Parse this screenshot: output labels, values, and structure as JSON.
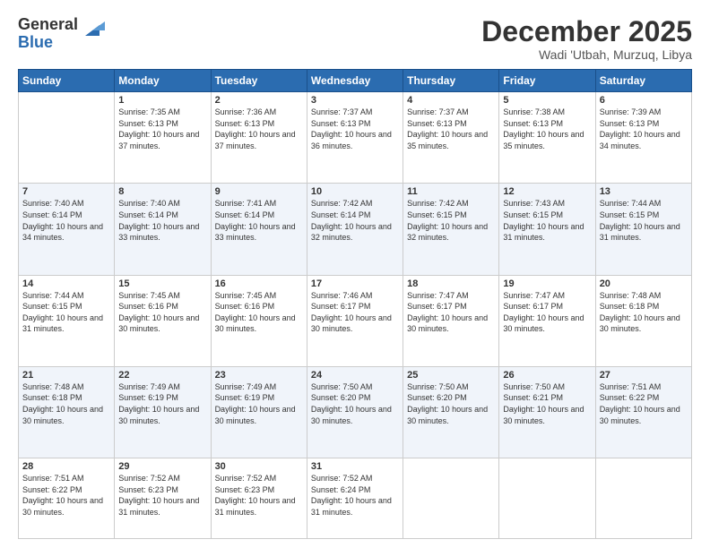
{
  "logo": {
    "general": "General",
    "blue": "Blue"
  },
  "header": {
    "title": "December 2025",
    "location": "Wadi 'Utbah, Murzuq, Libya"
  },
  "weekdays": [
    "Sunday",
    "Monday",
    "Tuesday",
    "Wednesday",
    "Thursday",
    "Friday",
    "Saturday"
  ],
  "days": {
    "1": {
      "sunrise": "7:35 AM",
      "sunset": "6:13 PM",
      "daylight": "10 hours and 37 minutes."
    },
    "2": {
      "sunrise": "7:36 AM",
      "sunset": "6:13 PM",
      "daylight": "10 hours and 37 minutes."
    },
    "3": {
      "sunrise": "7:37 AM",
      "sunset": "6:13 PM",
      "daylight": "10 hours and 36 minutes."
    },
    "4": {
      "sunrise": "7:37 AM",
      "sunset": "6:13 PM",
      "daylight": "10 hours and 35 minutes."
    },
    "5": {
      "sunrise": "7:38 AM",
      "sunset": "6:13 PM",
      "daylight": "10 hours and 35 minutes."
    },
    "6": {
      "sunrise": "7:39 AM",
      "sunset": "6:13 PM",
      "daylight": "10 hours and 34 minutes."
    },
    "7": {
      "sunrise": "7:40 AM",
      "sunset": "6:14 PM",
      "daylight": "10 hours and 34 minutes."
    },
    "8": {
      "sunrise": "7:40 AM",
      "sunset": "6:14 PM",
      "daylight": "10 hours and 33 minutes."
    },
    "9": {
      "sunrise": "7:41 AM",
      "sunset": "6:14 PM",
      "daylight": "10 hours and 33 minutes."
    },
    "10": {
      "sunrise": "7:42 AM",
      "sunset": "6:14 PM",
      "daylight": "10 hours and 32 minutes."
    },
    "11": {
      "sunrise": "7:42 AM",
      "sunset": "6:15 PM",
      "daylight": "10 hours and 32 minutes."
    },
    "12": {
      "sunrise": "7:43 AM",
      "sunset": "6:15 PM",
      "daylight": "10 hours and 31 minutes."
    },
    "13": {
      "sunrise": "7:44 AM",
      "sunset": "6:15 PM",
      "daylight": "10 hours and 31 minutes."
    },
    "14": {
      "sunrise": "7:44 AM",
      "sunset": "6:15 PM",
      "daylight": "10 hours and 31 minutes."
    },
    "15": {
      "sunrise": "7:45 AM",
      "sunset": "6:16 PM",
      "daylight": "10 hours and 30 minutes."
    },
    "16": {
      "sunrise": "7:45 AM",
      "sunset": "6:16 PM",
      "daylight": "10 hours and 30 minutes."
    },
    "17": {
      "sunrise": "7:46 AM",
      "sunset": "6:17 PM",
      "daylight": "10 hours and 30 minutes."
    },
    "18": {
      "sunrise": "7:47 AM",
      "sunset": "6:17 PM",
      "daylight": "10 hours and 30 minutes."
    },
    "19": {
      "sunrise": "7:47 AM",
      "sunset": "6:17 PM",
      "daylight": "10 hours and 30 minutes."
    },
    "20": {
      "sunrise": "7:48 AM",
      "sunset": "6:18 PM",
      "daylight": "10 hours and 30 minutes."
    },
    "21": {
      "sunrise": "7:48 AM",
      "sunset": "6:18 PM",
      "daylight": "10 hours and 30 minutes."
    },
    "22": {
      "sunrise": "7:49 AM",
      "sunset": "6:19 PM",
      "daylight": "10 hours and 30 minutes."
    },
    "23": {
      "sunrise": "7:49 AM",
      "sunset": "6:19 PM",
      "daylight": "10 hours and 30 minutes."
    },
    "24": {
      "sunrise": "7:50 AM",
      "sunset": "6:20 PM",
      "daylight": "10 hours and 30 minutes."
    },
    "25": {
      "sunrise": "7:50 AM",
      "sunset": "6:20 PM",
      "daylight": "10 hours and 30 minutes."
    },
    "26": {
      "sunrise": "7:50 AM",
      "sunset": "6:21 PM",
      "daylight": "10 hours and 30 minutes."
    },
    "27": {
      "sunrise": "7:51 AM",
      "sunset": "6:22 PM",
      "daylight": "10 hours and 30 minutes."
    },
    "28": {
      "sunrise": "7:51 AM",
      "sunset": "6:22 PM",
      "daylight": "10 hours and 30 minutes."
    },
    "29": {
      "sunrise": "7:52 AM",
      "sunset": "6:23 PM",
      "daylight": "10 hours and 31 minutes."
    },
    "30": {
      "sunrise": "7:52 AM",
      "sunset": "6:23 PM",
      "daylight": "10 hours and 31 minutes."
    },
    "31": {
      "sunrise": "7:52 AM",
      "sunset": "6:24 PM",
      "daylight": "10 hours and 31 minutes."
    }
  }
}
